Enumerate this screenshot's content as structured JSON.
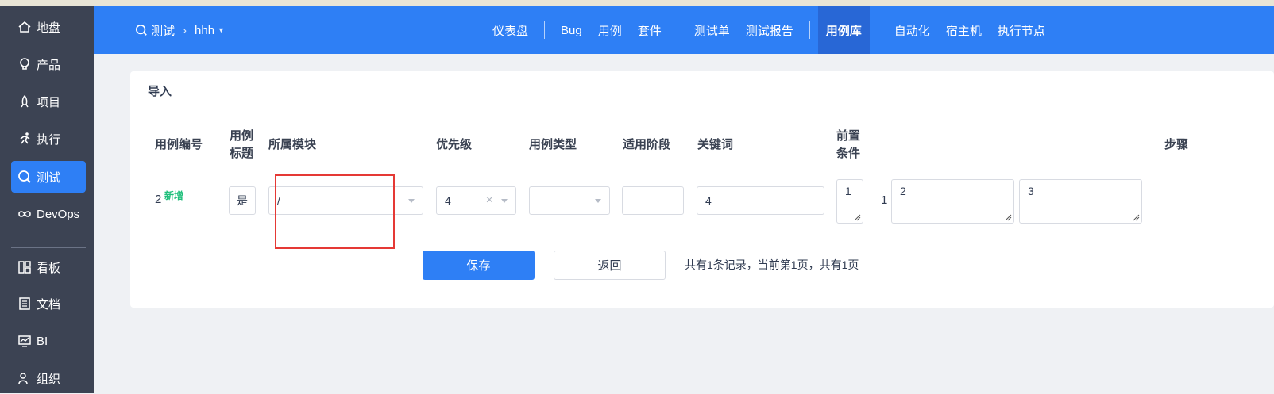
{
  "sidebar": {
    "items": [
      {
        "label": "地盘",
        "icon": "home-icon"
      },
      {
        "label": "产品",
        "icon": "lightbulb-icon"
      },
      {
        "label": "项目",
        "icon": "rocket-icon"
      },
      {
        "label": "执行",
        "icon": "run-icon"
      },
      {
        "label": "测试",
        "icon": "test-search-icon",
        "active": true
      },
      {
        "label": "DevOps",
        "icon": "infinity-icon"
      },
      {
        "label": "看板",
        "icon": "kanban-icon"
      },
      {
        "label": "文档",
        "icon": "document-icon"
      },
      {
        "label": "BI",
        "icon": "monitor-chart-icon"
      },
      {
        "label": "组织",
        "icon": "people-icon"
      }
    ]
  },
  "header": {
    "breadcrumb": {
      "module": "测试",
      "product": "hhh"
    },
    "nav": [
      "仪表盘",
      "Bug",
      "用例",
      "套件",
      "测试单",
      "测试报告",
      "用例库",
      "自动化",
      "宿主机",
      "执行节点"
    ],
    "active_nav": "用例库"
  },
  "panel": {
    "title": "导入",
    "columns": {
      "case_id": "用例编号",
      "case_title": "用例\n标题",
      "module": "所属模块",
      "priority": "优先级",
      "case_type": "用例类型",
      "stage": "适用阶段",
      "keywords": "关键词",
      "precondition": "前置\n条件",
      "steps": "步骤"
    },
    "row": {
      "id": "2",
      "new_tag": "新增",
      "title_value": "是",
      "module_value": "/",
      "priority_value": "4",
      "case_type_value": "",
      "stage_value": "",
      "keywords_value": "4",
      "precondition_value": "1",
      "step_no": "1",
      "step_desc": "2",
      "step_expect": "3"
    },
    "save_label": "保存",
    "back_label": "返回",
    "pager_text": "共有1条记录，当前第1页，共有1页"
  },
  "colors": {
    "primary": "#2e7ff5",
    "sidebar": "#3c4353",
    "new_tag": "#1fbf7b",
    "highlight_box": "#e53935"
  }
}
